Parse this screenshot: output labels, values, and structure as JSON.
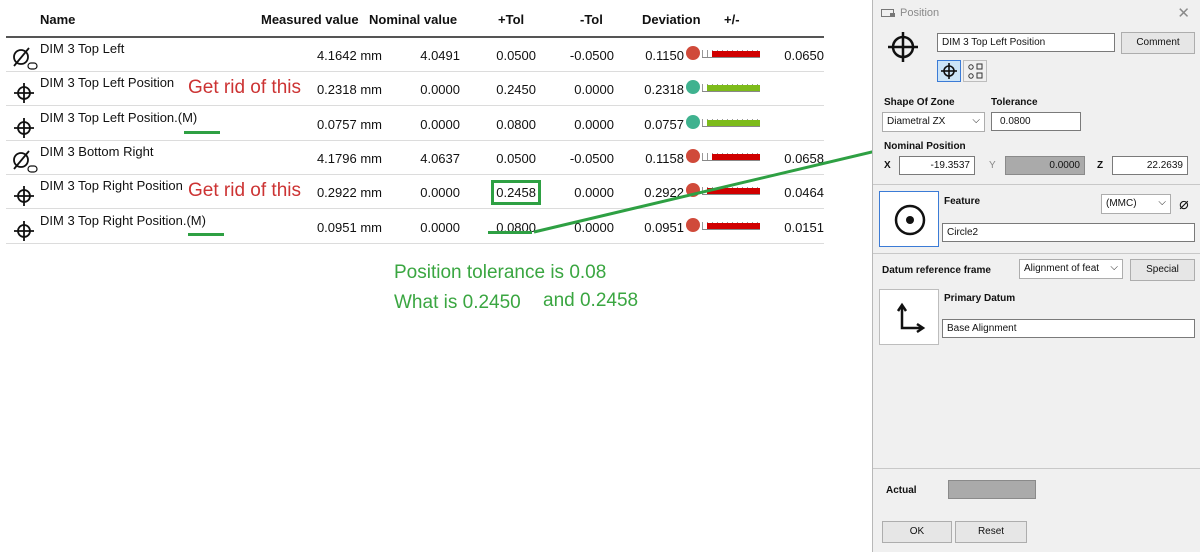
{
  "table": {
    "headers": {
      "name": "Name",
      "measured": "Measured value",
      "nominal": "Nominal value",
      "plus_tol": "+Tol",
      "minus_tol": "-Tol",
      "deviation": "Deviation",
      "plusminus": "+/-"
    },
    "rows": [
      {
        "icon": "diameter-icon",
        "name": "DIM 3 Top Left",
        "measured": "4.1642 mm",
        "nominal": "4.0491",
        "plus_tol": "0.0500",
        "minus_tol": "-0.0500",
        "deviation": "0.1150",
        "status_color": "#d04a3a",
        "bar_color": "#d00000",
        "out_of_tol": "0.0650",
        "bar_fill": 0.82
      },
      {
        "icon": "position-icon",
        "name": "DIM 3 Top Left Position",
        "measured": "0.2318 mm",
        "nominal": "0.0000",
        "plus_tol": "0.2450",
        "minus_tol": "0.0000",
        "deviation": "0.2318",
        "status_color": "#3fb28f",
        "bar_color": "#7dbb1a",
        "out_of_tol": "",
        "bar_fill": 0.92
      },
      {
        "icon": "position-icon",
        "name": "DIM 3 Top Left Position.(M)",
        "measured": "0.0757 mm",
        "nominal": "0.0000",
        "plus_tol": "0.0800",
        "minus_tol": "0.0000",
        "deviation": "0.0757",
        "status_color": "#3fb28f",
        "bar_color": "#7dbb1a",
        "out_of_tol": "",
        "bar_fill": 0.92
      },
      {
        "icon": "diameter-icon",
        "name": "DIM 3 Bottom Right",
        "measured": "4.1796 mm",
        "nominal": "4.0637",
        "plus_tol": "0.0500",
        "minus_tol": "-0.0500",
        "deviation": "0.1158",
        "status_color": "#d04a3a",
        "bar_color": "#d00000",
        "out_of_tol": "0.0658",
        "bar_fill": 0.82
      },
      {
        "icon": "position-icon",
        "name": "DIM 3 Top Right Position",
        "measured": "0.2922 mm",
        "nominal": "0.0000",
        "plus_tol": "0.2458",
        "minus_tol": "0.0000",
        "deviation": "0.2922",
        "status_color": "#d04a3a",
        "bar_color": "#d00000",
        "out_of_tol": "0.0464",
        "bar_fill": 0.92
      },
      {
        "icon": "position-icon",
        "name": "DIM 3 Top Right Position.(M)",
        "measured": "0.0951 mm",
        "nominal": "0.0000",
        "plus_tol": "0.0800",
        "minus_tol": "0.0000",
        "deviation": "0.0951",
        "status_color": "#d04a3a",
        "bar_color": "#d00000",
        "out_of_tol": "0.0151",
        "bar_fill": 0.92
      }
    ]
  },
  "annotations": {
    "remove_note_1": "Get rid of this",
    "remove_note_2": "Get rid of this",
    "question_line_1": "Position tolerance is 0.08",
    "question_line_2a": "What is 0.2450",
    "question_line_2b": "and 0.2458",
    "annotation_color": "#2ea043",
    "remove_note_color": "#cc3333"
  },
  "dialog": {
    "title": "Position",
    "name_value": "DIM 3 Top Left Position",
    "comment_label": "Comment",
    "shape_of_zone_label": "Shape Of Zone",
    "shape_of_zone_value": "Diametral ZX",
    "tolerance_label": "Tolerance",
    "tolerance_value": "0.0800",
    "nominal_position_label": "Nominal Position",
    "x_label": "X",
    "x_value": "-19.3537",
    "y_label": "Y",
    "y_value": "0.0000",
    "z_label": "Z",
    "z_value": "22.2639",
    "feature_label": "Feature",
    "material_modifier": "(MMC)",
    "feature_value": "Circle2",
    "datum_frame_label": "Datum reference frame",
    "datum_frame_value": "Alignment of feat",
    "special_label": "Special",
    "primary_datum_label": "Primary Datum",
    "primary_datum_value": "Base Alignment",
    "actual_label": "Actual",
    "ok_label": "OK",
    "reset_label": "Reset"
  }
}
